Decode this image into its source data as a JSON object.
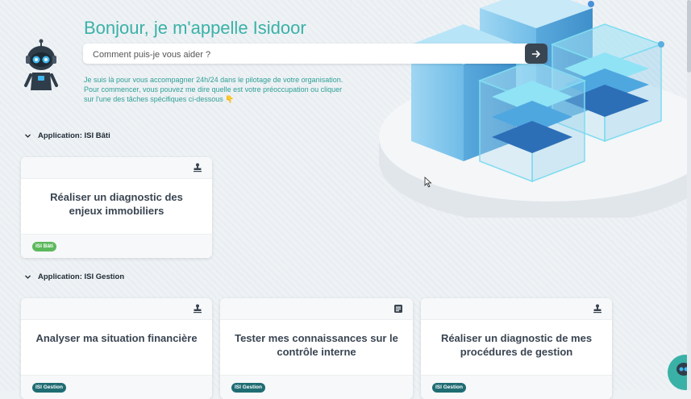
{
  "header": {
    "title": "Bonjour, je m'appelle Isidoor",
    "search_placeholder": "Comment puis-je vous aider ?",
    "intro_lines": [
      "Je suis là pour vous accompagner 24h/24 dans le pilotage de votre organisation.",
      "Pour commencer, vous pouvez me dire quelle est votre préoccupation ou cliquer",
      "sur l'une des tâches spécifiques ci-dessous 👇"
    ]
  },
  "sections": [
    {
      "label": "Application: ISI Bâti",
      "cards": [
        {
          "title_lines": [
            "Réaliser un diagnostic des",
            "enjeux immobiliers"
          ],
          "tag": "ISI Bâti",
          "icon": "stamp-icon"
        }
      ]
    },
    {
      "label": "Application: ISI Gestion",
      "cards": [
        {
          "title_lines": [
            "Analyser ma situation financière"
          ],
          "tag": "ISI Gestion",
          "icon": "stamp-icon"
        },
        {
          "title_lines": [
            "Tester mes connaissances sur le",
            "contrôle interne"
          ],
          "tag": "ISI Gestion",
          "icon": "quiz-icon"
        },
        {
          "title_lines": [
            "Réaliser un diagnostic de mes",
            "procédures de gestion"
          ],
          "tag": "ISI Gestion",
          "icon": "stamp-icon"
        }
      ]
    }
  ],
  "colors": {
    "accent": "#3ab1a7",
    "dark": "#3a4552",
    "tag_green": "#5cb85c",
    "tag_teal": "#1f6d73"
  }
}
